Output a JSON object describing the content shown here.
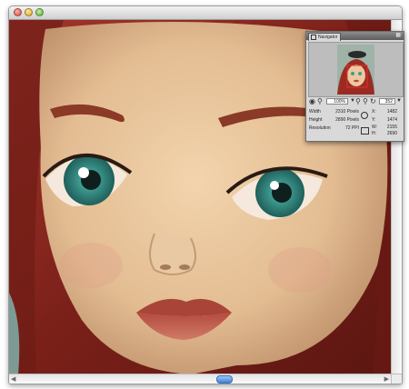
{
  "window": {
    "controls": [
      "close",
      "minimize",
      "zoom"
    ]
  },
  "canvas": {
    "image": "painted portrait of a red-haired girl with large teal eyes and red lips (zoomed in)"
  },
  "navigator": {
    "tab_label": "Navigator",
    "zoom_left": "100%",
    "zoom_right": "352",
    "info": {
      "width_label": "Width",
      "width_value": "2310 Pixels",
      "height_label": "Height",
      "height_value": "2890 Pixels",
      "resolution_label": "Resolution",
      "resolution_value": "72 PPI",
      "x_label": "X:",
      "x_value": "1482",
      "y_label": "Y:",
      "y_value": "1474",
      "w_label": "W:",
      "w_value": "2155",
      "h_label": "H:",
      "h_value": "2690"
    }
  },
  "colors": {
    "hair": "#8c2a22",
    "skin": "#e6c49a",
    "eye_iris": "#3f9c92",
    "lips": "#b8574a",
    "background_sky": "#9fb3a8"
  }
}
